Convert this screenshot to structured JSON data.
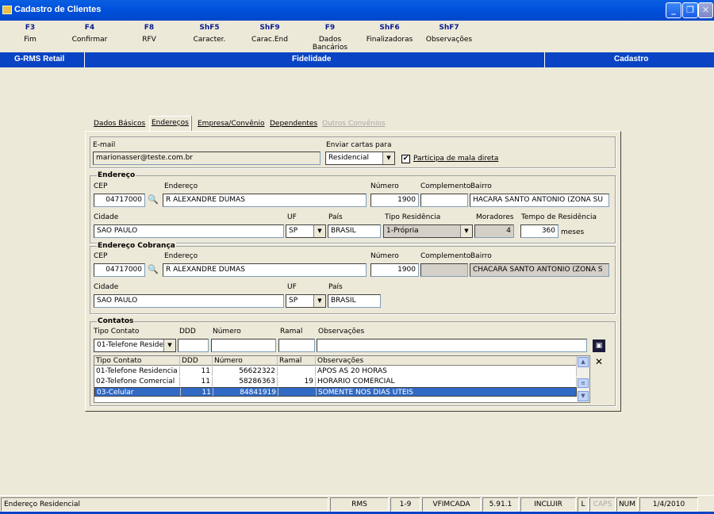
{
  "window": {
    "title": "Cadastro de Clientes",
    "min": "_",
    "max": "❐",
    "close": "✕"
  },
  "fkeys": [
    {
      "key": "F3",
      "label": "Fim"
    },
    {
      "key": "F4",
      "label": "Confirmar"
    },
    {
      "key": "F8",
      "label": "RFV"
    },
    {
      "key": "ShF5",
      "label": "Caracter."
    },
    {
      "key": "ShF9",
      "label": "Carac.End"
    },
    {
      "key": "F9",
      "label": "Dados Bancários"
    },
    {
      "key": "ShF6",
      "label": "Finalizadoras"
    },
    {
      "key": "ShF7",
      "label": "Observações"
    }
  ],
  "bluebar": {
    "left": "G-RMS Retail",
    "center": "Fidelidade",
    "right": "Cadastro"
  },
  "tabs": [
    "Dados Básicos",
    "Endereços",
    "Empresa/Convênio",
    "Dependentes",
    "Outros Convênios"
  ],
  "email": {
    "label": "E-mail",
    "value": "marionasser@teste.com.br"
  },
  "cartas": {
    "label": "Enviar cartas para",
    "value": "Residencial",
    "checkbox_label": "Participa de mala direta",
    "checked": "✔"
  },
  "endereco": {
    "title": "Endereço",
    "cep_label": "CEP",
    "cep": "04717000",
    "end_label": "Endereço",
    "end": "R ALEXANDRE DUMAS",
    "num_label": "Número",
    "num": "1900",
    "comp_label": "Complemento",
    "comp": "",
    "bairro_label": "Bairro",
    "bairro": "HACARA SANTO ANTONIO (ZONA SU",
    "cidade_label": "Cidade",
    "cidade": "SAO PAULO",
    "uf_label": "UF",
    "uf": "SP",
    "pais_label": "País",
    "pais": "BRASIL",
    "tipo_label": "Tipo Residência",
    "tipo": "1-Própria",
    "mor_label": "Moradores",
    "mor": "4",
    "tempo_label": "Tempo de Residência",
    "tempo": "360",
    "meses": "meses"
  },
  "cobranca": {
    "title": "Endereço Cobrança",
    "cep_label": "CEP",
    "cep": "04717000",
    "end_label": "Endereço",
    "end": "R ALEXANDRE DUMAS",
    "num_label": "Número",
    "num": "1900",
    "comp_label": "Complemento",
    "comp": "",
    "bairro_label": "Bairro",
    "bairro": "CHACARA SANTO ANTONIO (ZONA S",
    "cidade_label": "Cidade",
    "cidade": "SAO PAULO",
    "uf_label": "UF",
    "uf": "SP",
    "pais_label": "País",
    "pais": "BRASIL"
  },
  "contatos": {
    "title": "Contatos",
    "tipo_label": "Tipo Contato",
    "tipo": "01-Telefone Reside",
    "ddd_label": "DDD",
    "num_label": "Número",
    "ramal_label": "Ramal",
    "obs_label": "Observações",
    "headers": [
      "Tipo Contato",
      "DDD",
      "Número",
      "Ramal",
      "Observações"
    ],
    "rows": [
      [
        "01-Telefone Residencia",
        "11",
        "56622322",
        "",
        "APOS AS 20 HORAS"
      ],
      [
        "02-Telefone Comercial",
        "11",
        "58286363",
        "19",
        "HORARIO COMERCIAL"
      ],
      [
        "03-Celular",
        "11",
        "84841919",
        "",
        "SOMENTE NOS DIAS UTEIS"
      ]
    ]
  },
  "status": [
    "Endereço Residencial",
    "RMS",
    "1-9",
    "VFIMCADA",
    "5.91.1",
    "INCLUIR",
    "L",
    "CAPS",
    "NUM",
    "1/4/2010"
  ]
}
